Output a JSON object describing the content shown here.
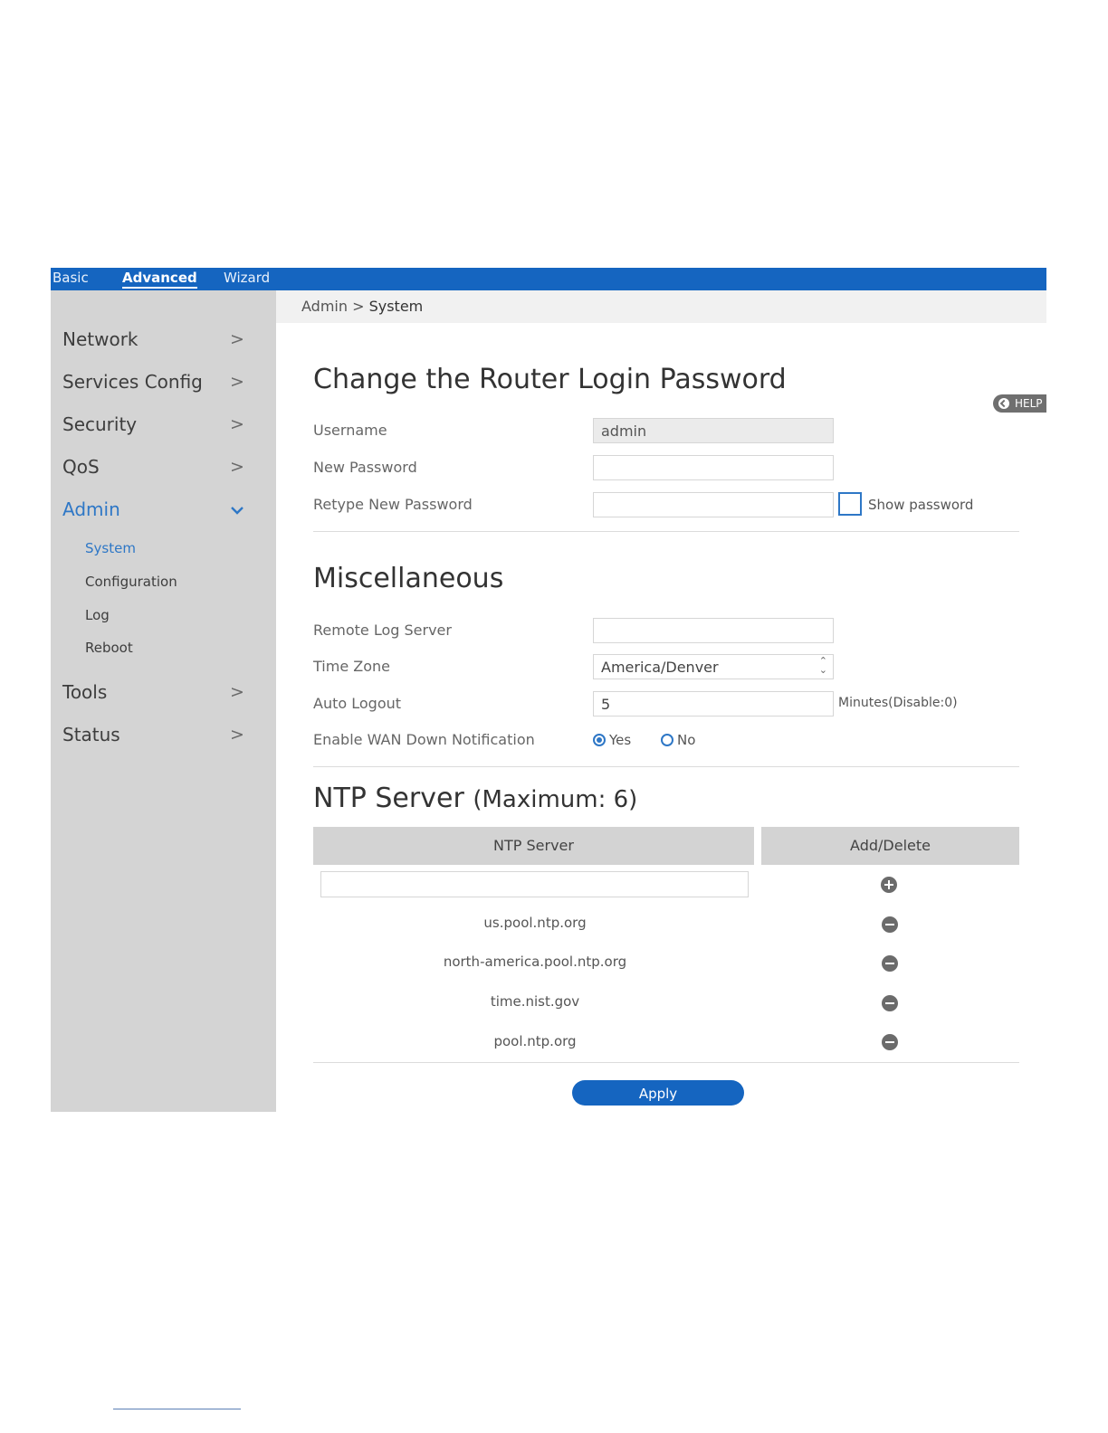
{
  "topbar": {
    "tabs": [
      "Basic",
      "Advanced",
      "Wizard"
    ],
    "active": "Advanced"
  },
  "sidebar": {
    "items": [
      {
        "label": "Network"
      },
      {
        "label": "Services Config"
      },
      {
        "label": "Security"
      },
      {
        "label": "QoS"
      },
      {
        "label": "Admin",
        "expanded": true
      },
      {
        "label": "Tools"
      },
      {
        "label": "Status"
      }
    ],
    "subitems": [
      "System",
      "Configuration",
      "Log",
      "Reboot"
    ],
    "active_subitem": "System"
  },
  "breadcrumb": {
    "parent": "Admin",
    "separator": ">",
    "current": "System"
  },
  "help_label": "HELP",
  "password": {
    "title": "Change the Router Login Password",
    "username_label": "Username",
    "username_value": "admin",
    "new_password_label": "New Password",
    "new_password_value": "",
    "retype_label": "Retype New Password",
    "retype_value": "",
    "show_password_label": "Show password",
    "show_password_checked": false
  },
  "misc": {
    "title": "Miscellaneous",
    "remote_log_label": "Remote Log Server",
    "remote_log_value": "",
    "timezone_label": "Time Zone",
    "timezone_value": "America/Denver",
    "auto_logout_label": "Auto Logout",
    "auto_logout_value": "5",
    "auto_logout_note": "Minutes(Disable:0)",
    "wan_label": "Enable WAN Down Notification",
    "wan_yes": "Yes",
    "wan_no": "No",
    "wan_selected": "Yes"
  },
  "ntp": {
    "title": "NTP Server",
    "title_suffix": "(Maximum: 6)",
    "col_server": "NTP Server",
    "col_action": "Add/Delete",
    "new_server_value": "",
    "servers": [
      "us.pool.ntp.org",
      "north-america.pool.ntp.org",
      "time.nist.gov",
      "pool.ntp.org"
    ]
  },
  "apply_label": "Apply",
  "colors": {
    "brand": "#1565c0",
    "accent": "#2e77c6",
    "sidebar": "#d4d4d4"
  },
  "icons": {
    "chevron": "chevron-right-icon",
    "expanded": "chevron-down-icon",
    "add": "plus-circle-icon",
    "delete": "minus-circle-icon"
  }
}
